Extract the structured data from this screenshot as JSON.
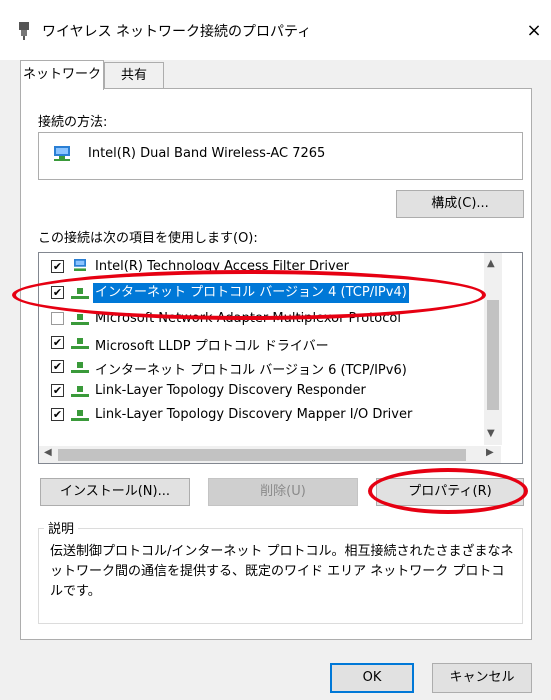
{
  "window": {
    "title": "ワイヤレス ネットワーク接続のプロパティ",
    "close": "×"
  },
  "tabs": [
    {
      "label": "ネットワーク"
    },
    {
      "label": "共有"
    }
  ],
  "connect_using": {
    "label": "接続の方法:",
    "adapter": "Intel(R) Dual Band Wireless-AC 7265"
  },
  "buttons": {
    "configure": "構成(C)...",
    "install": "インストール(N)...",
    "uninstall": "削除(U)",
    "properties": "プロパティ(R)",
    "ok": "OK",
    "cancel": "キャンセル"
  },
  "items_label": "この接続は次の項目を使用します(O):",
  "items": [
    {
      "label": "Intel(R) Technology Access Filter Driver",
      "checked": true
    },
    {
      "label": "インターネット プロトコル バージョン 4 (TCP/IPv4)",
      "checked": true,
      "selected": true
    },
    {
      "label": "Microsoft Network Adapter Multiplexor Protocol",
      "checked": false
    },
    {
      "label": "Microsoft LLDP プロトコル ドライバー",
      "checked": true
    },
    {
      "label": "インターネット プロトコル バージョン 6 (TCP/IPv6)",
      "checked": true
    },
    {
      "label": "Link-Layer Topology Discovery Responder",
      "checked": true
    },
    {
      "label": "Link-Layer Topology Discovery Mapper I/O Driver",
      "checked": true
    }
  ],
  "description": {
    "title": "説明",
    "text": "伝送制御プロトコル/インターネット プロトコル。相互接続されたさまざまなネットワーク間の通信を提供する、既定のワイド エリア ネットワーク プロトコルです。"
  },
  "colors": {
    "accent": "#0078d7",
    "highlight_oval": "#e60012"
  },
  "icons": {
    "title": "network-adapter-icon",
    "adapter": "network-adapter-icon",
    "item": "network-component-icon"
  }
}
